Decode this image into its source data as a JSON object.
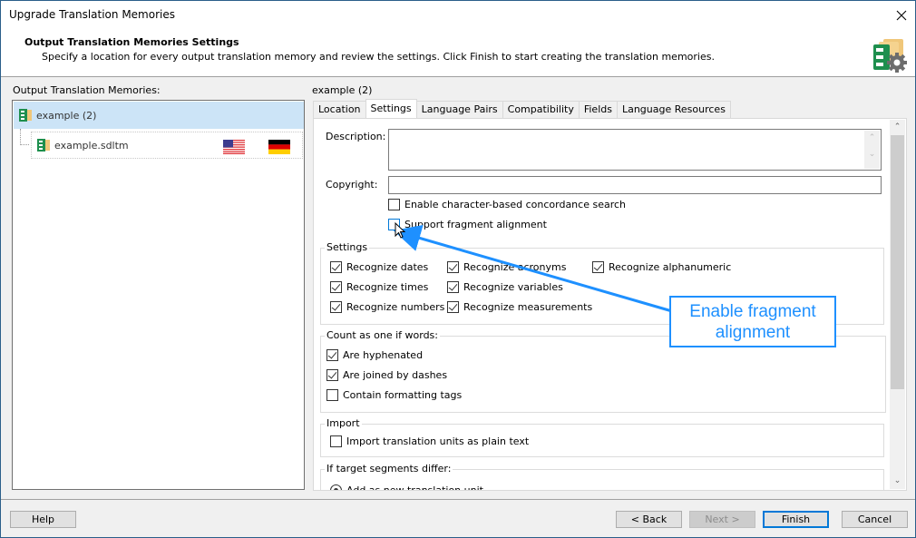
{
  "window": {
    "title": "Upgrade Translation Memories",
    "close_icon": "close-icon"
  },
  "header": {
    "title": "Output Translation Memories Settings",
    "subtitle": "Specify a location for every output translation memory and review the settings. Click Finish to start creating the translation memories.",
    "icon": "translation-memory-settings-icon"
  },
  "left_panel": {
    "label": "Output Translation Memories:",
    "tree": {
      "root": {
        "label": "example (2)",
        "icon": "translation-memory-icon",
        "selected": true
      },
      "children": [
        {
          "label": "example.sdltm",
          "icon": "translation-memory-icon",
          "source_flag": "us-flag",
          "target_flag": "de-flag"
        }
      ]
    }
  },
  "right_panel": {
    "label": "example (2)",
    "tabs": [
      {
        "label": "Location",
        "active": false
      },
      {
        "label": "Settings",
        "active": true
      },
      {
        "label": "Language Pairs",
        "active": false
      },
      {
        "label": "Compatibility",
        "active": false
      },
      {
        "label": "Fields",
        "active": false
      },
      {
        "label": "Language Resources",
        "active": false
      }
    ],
    "settings": {
      "description_label": "Description:",
      "description_value": "",
      "copyright_label": "Copyright:",
      "copyright_value": "",
      "enable_char_concordance": {
        "label": "Enable character-based concordance search",
        "checked": false
      },
      "support_fragment_alignment": {
        "label": "Support fragment alignment",
        "checked": false
      },
      "settings_group": {
        "title": "Settings",
        "items": [
          {
            "label": "Recognize dates",
            "checked": true
          },
          {
            "label": "Recognize acronyms",
            "checked": true
          },
          {
            "label": "Recognize alphanumeric",
            "checked": true
          },
          {
            "label": "Recognize times",
            "checked": true
          },
          {
            "label": "Recognize variables",
            "checked": true
          },
          {
            "label": "Recognize numbers",
            "checked": true
          },
          {
            "label": "Recognize measurements",
            "checked": true
          }
        ]
      },
      "count_group": {
        "title": "Count as one if words:",
        "items": [
          {
            "label": "Are hyphenated",
            "checked": true
          },
          {
            "label": "Are joined by dashes",
            "checked": true
          },
          {
            "label": "Contain formatting tags",
            "checked": false
          }
        ]
      },
      "import_group": {
        "title": "Import",
        "items": [
          {
            "label": "Import translation units as plain text",
            "checked": false
          }
        ]
      },
      "target_differ_group": {
        "title": "If target segments differ:",
        "option": "Add as new translation unit"
      }
    }
  },
  "annotation": {
    "callout_text_line1": "Enable fragment",
    "callout_text_line2": "alignment",
    "color": "#1e90ff"
  },
  "footer": {
    "help": "Help",
    "back": "< Back",
    "next": "Next >",
    "finish": "Finish",
    "cancel": "Cancel"
  }
}
